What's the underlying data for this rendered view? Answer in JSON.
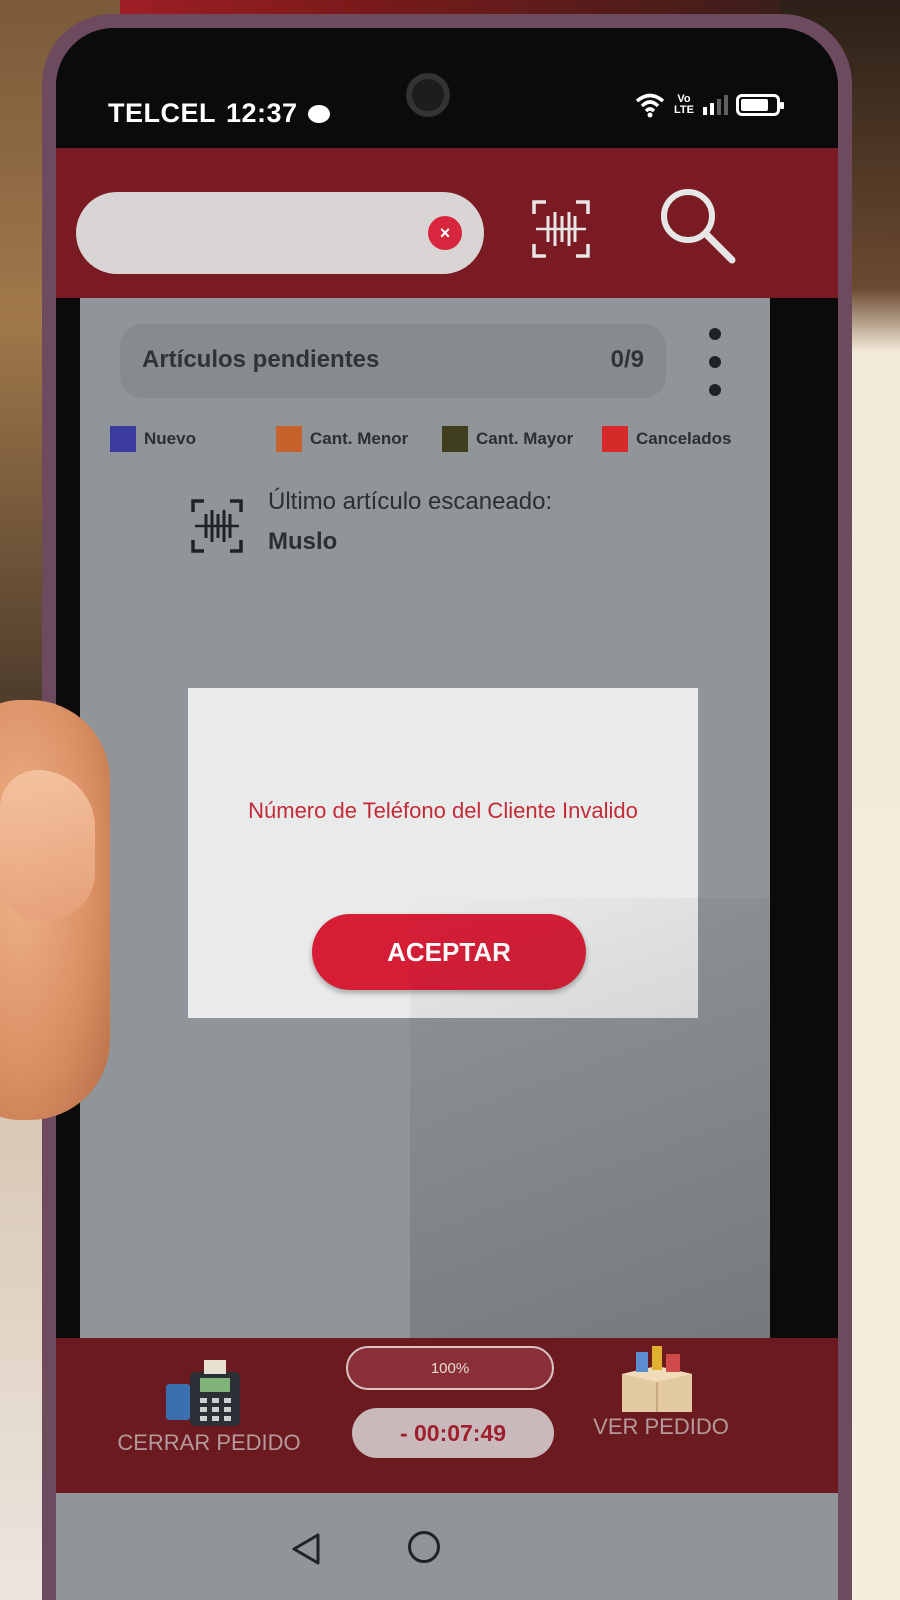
{
  "status_bar": {
    "carrier": "TELCEL",
    "time": "12:37",
    "volte_label": "Vo LTE"
  },
  "header": {
    "search": {
      "value": "",
      "placeholder": ""
    },
    "clear_icon": "×",
    "scan_icon": "barcode-scan-icon",
    "search_icon": "magnifier-icon"
  },
  "pending": {
    "title": "Artículos pendientes",
    "count": "0/9"
  },
  "legend": [
    {
      "label": "Nuevo",
      "color": "#3b3a9e"
    },
    {
      "label": "Cant. Menor",
      "color": "#c7622a"
    },
    {
      "label": "Cant. Mayor",
      "color": "#3f3f1f"
    },
    {
      "label": "Cancelados",
      "color": "#d62a2a"
    }
  ],
  "last_scan": {
    "label": "Último artículo escaneado:",
    "value": "Muslo"
  },
  "dialog": {
    "message": "Número de Teléfono del Cliente Invalido",
    "accept_label": "ACEPTAR"
  },
  "bottom": {
    "close_order_label": "CERRAR PEDIDO",
    "progress_text": "100%",
    "timer": "- 00:07:49",
    "view_order_label": "VER PEDIDO"
  },
  "colors": {
    "brand": "#7a1a22",
    "accent": "#d51e36",
    "dialog_text": "#c42a38"
  }
}
